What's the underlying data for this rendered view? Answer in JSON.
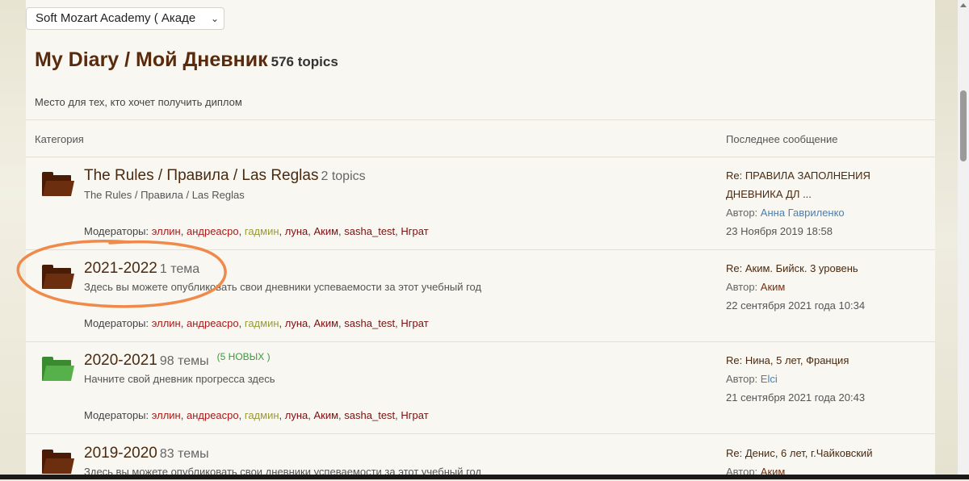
{
  "forum_select": {
    "value": "Soft Mozart Academy ( Акаде"
  },
  "page": {
    "title": "My Diary / Мой Дневник",
    "topics_count": "576 topics",
    "description": "Место для тех, кто хочет получить диплом"
  },
  "table_header": {
    "category": "Категория",
    "last_post": "Последнее сообщение"
  },
  "categories": [
    {
      "title": "The Rules / Правила / Las Reglas",
      "count": "2 topics",
      "description": "The Rules / Правила / Las Reglas",
      "moderators_label": "Модераторы:",
      "moderators": [
        "эллин",
        "андреасро",
        "гадмин",
        "луна",
        "Аким",
        "sasha_test",
        "Нграт"
      ],
      "last_post": {
        "title_line1": "Re: ПРАВИЛА ЗАПОЛНЕНИЯ",
        "title_line2": "ДНЕВНИКА ДЛ ...",
        "author_label": "Автор:",
        "author": "Анна Гавриленко",
        "date": "23 Ноября 2019 18:58"
      }
    },
    {
      "title": "2021-2022",
      "count": "1 тема",
      "description": "Здесь вы можете опубликовать свои дневники успеваемости за этот учебный год",
      "moderators_label": "Модераторы:",
      "moderators": [
        "эллин",
        "андреасро",
        "гадмин",
        "луна",
        "Аким",
        "sasha_test",
        "Нграт"
      ],
      "last_post": {
        "title_line1": "Re: Аким. Бийск. 3 уровень",
        "author_label": "Автор:",
        "author": "Аким",
        "date": "22 сентября 2021 года 10:34"
      }
    },
    {
      "title": "2020-2021",
      "count": "98 темы",
      "new_badge": "(5 НОВЫХ )",
      "description": "Начните свой дневник прогресса здесь",
      "moderators_label": "Модераторы:",
      "moderators": [
        "эллин",
        "андреасро",
        "гадмин",
        "луна",
        "Аким",
        "sasha_test",
        "Нграт"
      ],
      "last_post": {
        "title_line1": "Re: Нина, 5 лет, Франция",
        "author_label": "Автор:",
        "author": "Elci",
        "date": "21 сентября 2021 года 20:43"
      }
    },
    {
      "title": "2019-2020",
      "count": "83 темы",
      "description": "Здесь вы можете опубликовать свои дневники успеваемости за этот учебный год",
      "last_post": {
        "title_line1": "Re: Денис, 6 лет, г.Чайковский",
        "author_label": "Автор:",
        "author": "Аким"
      }
    }
  ],
  "colors": {
    "title_brown": "#5a2a0c",
    "folder_brown": "#6b2e0e",
    "folder_green": "#56b14a",
    "annotation_orange": "#f08a4b",
    "new_green": "#3a9a3a"
  }
}
